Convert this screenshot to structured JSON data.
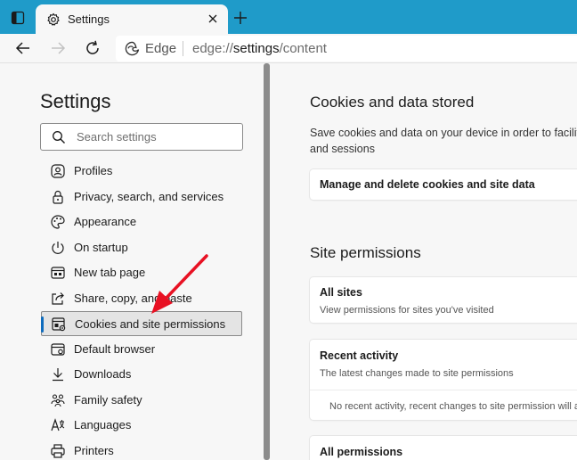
{
  "browser": {
    "tab_title": "Settings",
    "address_brand": "Edge",
    "address_url_prefix": "edge://",
    "address_url_bold": "settings",
    "address_url_suffix": "/content",
    "accent_color": "#1f9bc9"
  },
  "sidebar": {
    "title": "Settings",
    "search_placeholder": "Search settings",
    "items": [
      {
        "label": "Profiles",
        "icon": "profile-icon"
      },
      {
        "label": "Privacy, search, and services",
        "icon": "lock-icon"
      },
      {
        "label": "Appearance",
        "icon": "palette-icon"
      },
      {
        "label": "On startup",
        "icon": "power-icon"
      },
      {
        "label": "New tab page",
        "icon": "new-tab-icon"
      },
      {
        "label": "Share, copy, and paste",
        "icon": "share-icon"
      },
      {
        "label": "Cookies and site permissions",
        "icon": "cookie-settings-icon",
        "active": true
      },
      {
        "label": "Default browser",
        "icon": "browser-icon"
      },
      {
        "label": "Downloads",
        "icon": "download-icon"
      },
      {
        "label": "Family safety",
        "icon": "family-icon"
      },
      {
        "label": "Languages",
        "icon": "language-icon"
      },
      {
        "label": "Printers",
        "icon": "printer-icon"
      }
    ]
  },
  "main": {
    "cookies_heading": "Cookies and data stored",
    "cookies_desc_line1": "Save cookies and data on your device in order to facilit",
    "cookies_desc_line2": "and sessions",
    "manage_cookies_label": "Manage and delete cookies and site data",
    "site_permissions_heading": "Site permissions",
    "all_sites_title": "All sites",
    "all_sites_desc": "View permissions for sites you've visited",
    "recent_activity_title": "Recent activity",
    "recent_activity_desc": "The latest changes made to site permissions",
    "recent_activity_empty": "No recent activity, recent changes to site permission will ap",
    "all_permissions_title": "All permissions"
  },
  "annotation": {
    "arrow_color": "#e81123"
  }
}
